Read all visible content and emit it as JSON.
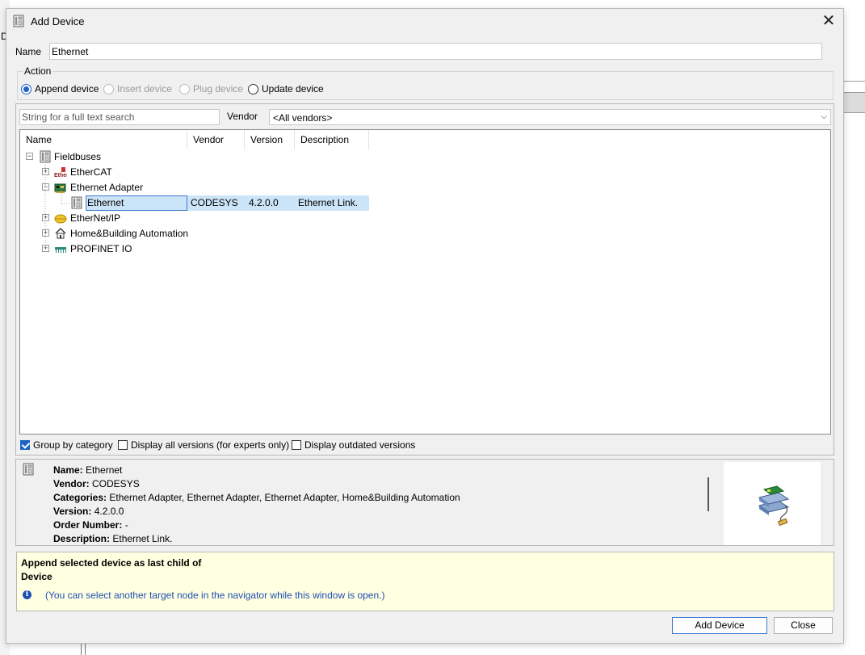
{
  "background": {
    "letter": "D"
  },
  "dialog": {
    "title": "Add Device",
    "close_glyph": "✕"
  },
  "name_field": {
    "label": "Name",
    "value": "Ethernet"
  },
  "action": {
    "label": "Action",
    "options": [
      {
        "label": "Append device",
        "selected": true,
        "enabled": true
      },
      {
        "label": "Insert device",
        "selected": false,
        "enabled": false
      },
      {
        "label": "Plug device",
        "selected": false,
        "enabled": false
      },
      {
        "label": "Update device",
        "selected": false,
        "enabled": true
      }
    ]
  },
  "search": {
    "placeholder": "String for a full text search",
    "vendor_label": "Vendor",
    "vendor_value": "<All vendors>"
  },
  "tree": {
    "columns": [
      "Name",
      "Vendor",
      "Version",
      "Description"
    ],
    "root": {
      "label": "Fieldbuses",
      "expander": "−"
    },
    "items": [
      {
        "label": "EtherCAT",
        "expander": "+",
        "icon": "ethercat-icon"
      },
      {
        "label": "Ethernet Adapter",
        "expander": "−",
        "icon": "ethernet-adapter-icon"
      },
      {
        "label": "Ethernet",
        "vendor": "CODESYS",
        "version": "4.2.0.0",
        "description": "Ethernet Link.",
        "icon": "device-icon",
        "selected": true
      },
      {
        "label": "EtherNet/IP",
        "expander": "+",
        "icon": "ethernet-ip-icon"
      },
      {
        "label": "Home&Building Automation",
        "expander": "+",
        "icon": "home-icon"
      },
      {
        "label": "PROFINET IO",
        "expander": "+",
        "icon": "profinet-icon"
      }
    ]
  },
  "options": {
    "group_by_category": {
      "label": "Group by category",
      "checked": true
    },
    "display_all_versions": {
      "label": "Display all versions (for experts only)",
      "checked": false
    },
    "display_outdated": {
      "label": "Display outdated versions",
      "checked": false
    }
  },
  "info": {
    "name_key": "Name:",
    "name_val": "Ethernet",
    "vendor_key": "Vendor:",
    "vendor_val": "CODESYS",
    "categories_key": "Categories:",
    "categories_val": "Ethernet Adapter, Ethernet Adapter, Ethernet Adapter, Home&Building Automation",
    "version_key": "Version:",
    "version_val": "4.2.0.0",
    "order_key": "Order Number:",
    "order_val": "-",
    "desc_key": "Description:",
    "desc_val": "Ethernet Link."
  },
  "note": {
    "line1": "Append selected device as last child of",
    "line2": "Device",
    "hint": "(You can select another target node in the navigator while this window is open.)"
  },
  "buttons": {
    "add": "Add Device",
    "close": "Close"
  },
  "colors": {
    "accent": "#1f63c6",
    "selection": "#cce4f7",
    "note_bg": "#ffffe1",
    "hint_text": "#1f4fb4"
  }
}
